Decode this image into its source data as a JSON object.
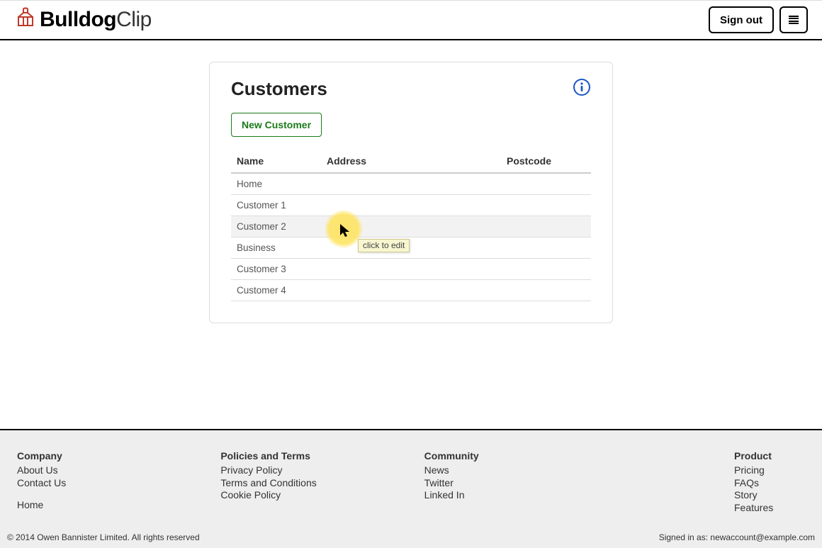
{
  "header": {
    "logo_bold": "Bulldog",
    "logo_thin": "Clip",
    "sign_out_label": "Sign out"
  },
  "page": {
    "title": "Customers",
    "new_button_label": "New Customer",
    "tooltip": "click to edit"
  },
  "table": {
    "headers": {
      "name": "Name",
      "address": "Address",
      "postcode": "Postcode"
    },
    "rows": [
      {
        "name": "Home",
        "address": "",
        "postcode": ""
      },
      {
        "name": "Customer 1",
        "address": "",
        "postcode": ""
      },
      {
        "name": "Customer 2",
        "address": "",
        "postcode": ""
      },
      {
        "name": "Business",
        "address": "",
        "postcode": ""
      },
      {
        "name": "Customer 3",
        "address": "",
        "postcode": ""
      },
      {
        "name": "Customer 4",
        "address": "",
        "postcode": ""
      }
    ],
    "highlighted_index": 2
  },
  "footer": {
    "cols": [
      {
        "heading": "Company",
        "links": [
          "About Us",
          "Contact Us"
        ],
        "extra_links": [
          "Home"
        ]
      },
      {
        "heading": "Policies and Terms",
        "links": [
          "Privacy Policy",
          "Terms and Conditions",
          "Cookie Policy"
        ]
      },
      {
        "heading": "Community",
        "links": [
          "News",
          "Twitter",
          "Linked In"
        ]
      },
      {
        "heading": "Product",
        "links": [
          "Pricing",
          "FAQs",
          "Story",
          "Features"
        ]
      }
    ],
    "copyright": "© 2014 Owen Bannister Limited. All rights reserved",
    "signed_in_prefix": "Signed in as: ",
    "signed_in_user": "newaccount@example.com"
  }
}
